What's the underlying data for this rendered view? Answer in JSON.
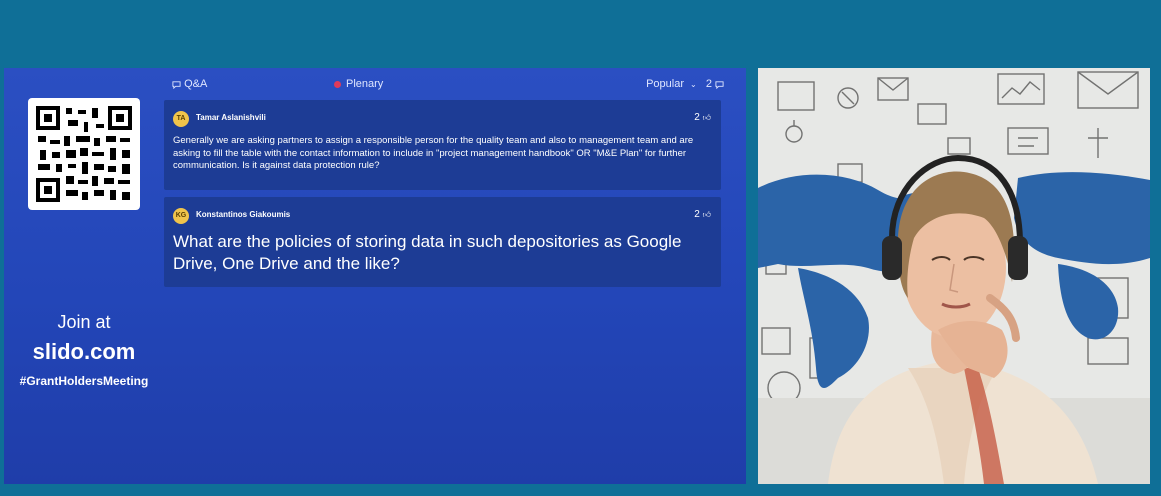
{
  "slido": {
    "join_text": "Join at",
    "site": "slido.com",
    "hashtag": "#GrantHoldersMeeting",
    "topbar": {
      "tab": "Q&A",
      "room": "Plenary",
      "sort": "Popular",
      "count": "2"
    },
    "questions": [
      {
        "initials": "TA",
        "author": "Tamar Aslanishvili",
        "likes": "2",
        "text": "Generally we are asking partners to assign a responsible person for the quality team and also to management team and are asking to fill the table with the contact information to include in \"project management handbook\" OR \"M&E Plan\" for further communication. Is it against data protection rule?"
      },
      {
        "initials": "KG",
        "author": "Konstantinos Giakoumis",
        "likes": "2",
        "text": "What are the policies of storing data in such depositories as Google Drive, One Drive and the like?"
      }
    ]
  },
  "icons": {
    "qa": "chat-bubble-icon",
    "like": "thumbs-up-icon",
    "chevron": "chevron-down-icon",
    "comment": "comment-icon"
  },
  "colors": {
    "background": "#0f6f97",
    "panel": "#2346b8",
    "card": "#1d3c95",
    "live_dot": "#e03a5a",
    "avatar": "#f0c44b"
  }
}
